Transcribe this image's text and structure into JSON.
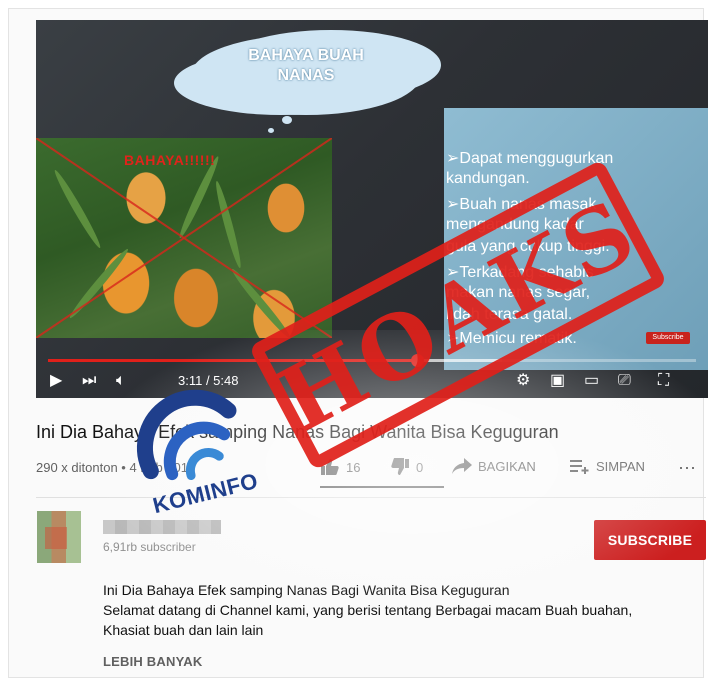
{
  "video": {
    "slide_title": "BAHAYA BUAH\nNANAS",
    "image_label": "BAHAYA!!!!!!",
    "bullets": [
      "➢Dapat menggugurkan",
      "kandungan.",
      "➢Buah nanas masak",
      "mengandung kadar",
      "gula yang cukup tinggi.",
      "➢Terkadang sehabis",
      "makan nanas segar,",
      "lidah terasa gatal.",
      "➢Memicu rematik."
    ],
    "sub_badge": "Subscribe",
    "time": "3:11 / 5:48",
    "played_fraction": 0.57,
    "buffered_fraction": 0.7
  },
  "info": {
    "title": "Ini Dia Bahaya Efek samping Nanas Bagi Wanita Bisa Keguguran",
    "meta": "290 x ditonton • 4 Feb 2018",
    "likes": "16",
    "dislikes": "0",
    "share_label": "BAGIKAN",
    "save_label": "SIMPAN",
    "more_icon": "⋯"
  },
  "channel": {
    "subs": "6,91rb subscriber",
    "subscribe_label": "SUBSCRIBE"
  },
  "description": {
    "line1": "Ini Dia Bahaya Efek samping Nanas Bagi Wanita Bisa Keguguran",
    "line2": "Selamat datang di Channel kami, yang berisi tentang Berbagai macam Buah buahan,",
    "line3": "Khasiat buah dan lain lain",
    "more": "LEBIH BANYAK"
  },
  "overlay": {
    "stamp": "HOAKS",
    "logo_text": "KOMINFO"
  },
  "colors": {
    "accent_red": "#e0201a",
    "subscribe_red": "#cc1f1f",
    "kominfo_blue": "#1f3f8c"
  }
}
